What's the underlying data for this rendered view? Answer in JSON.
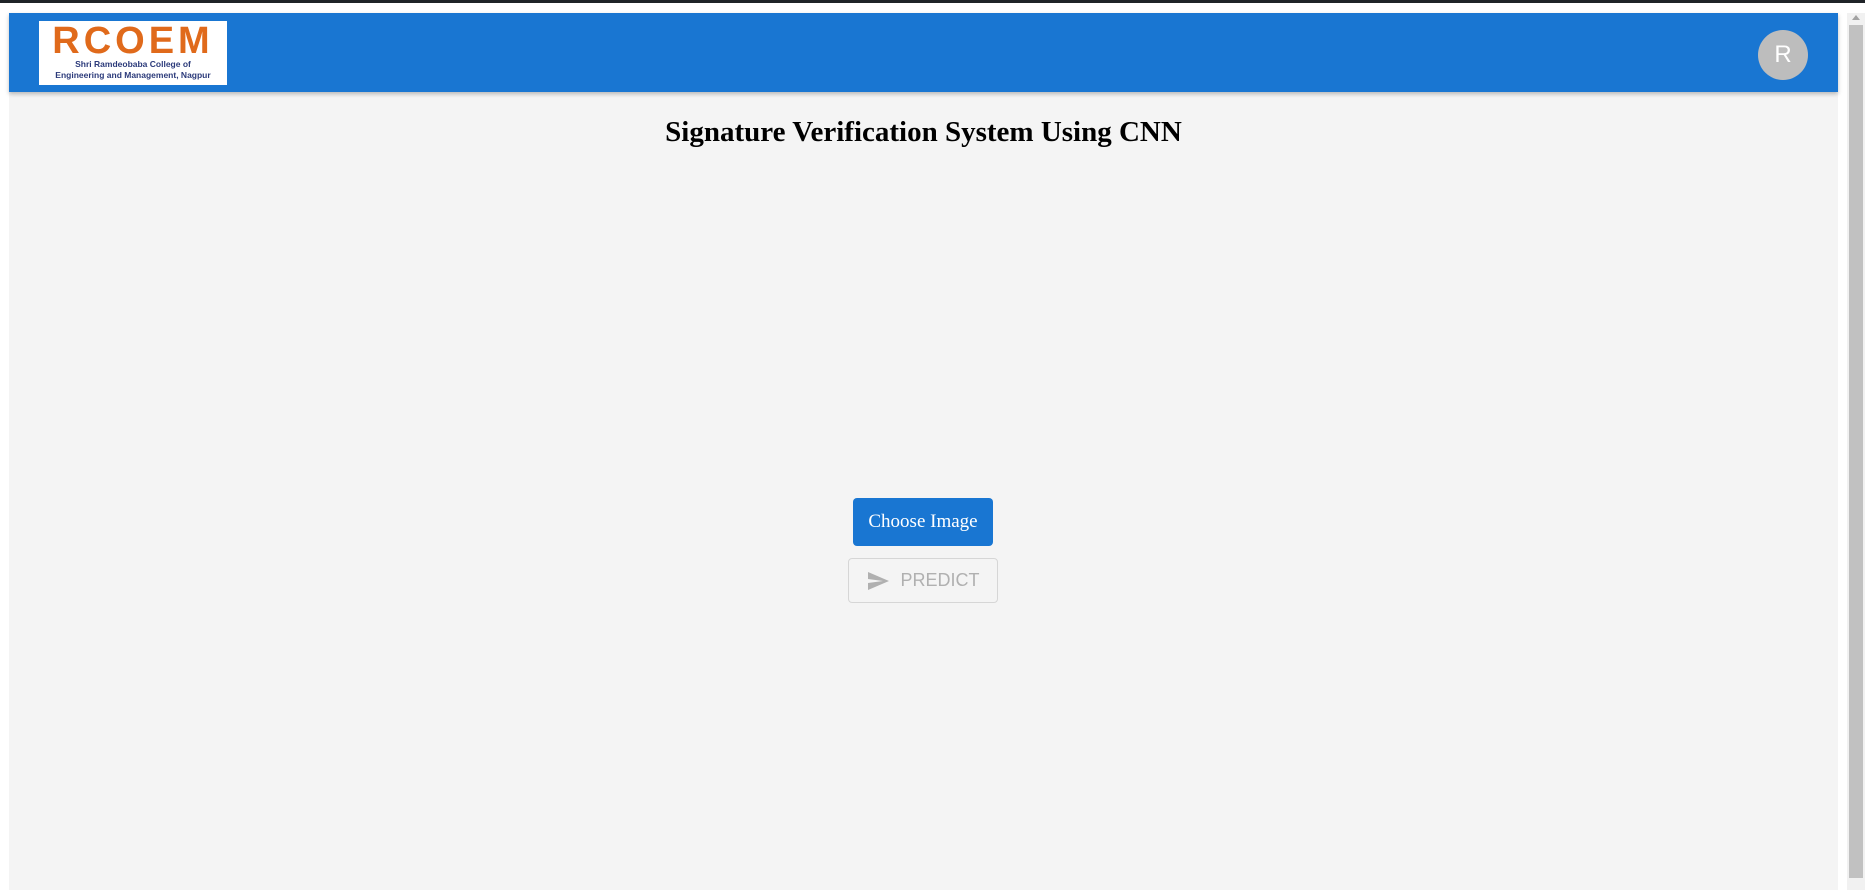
{
  "header": {
    "logo": {
      "mark": "RCOEM",
      "subtitle_line1": "Shri Ramdeobaba College of",
      "subtitle_line2": "Engineering and Management, Nagpur"
    },
    "avatar_initial": "R"
  },
  "main": {
    "title": "Signature Verification System Using CNN",
    "choose_image_label": "Choose Image",
    "predict_label": "PREDICT",
    "predict_icon": "send-icon"
  },
  "colors": {
    "appbar": "#1976d2",
    "background": "#f4f4f4",
    "logo_orange": "#e06a1b",
    "avatar": "#bdbdbd",
    "disabled_text": "#b0b0b0"
  }
}
